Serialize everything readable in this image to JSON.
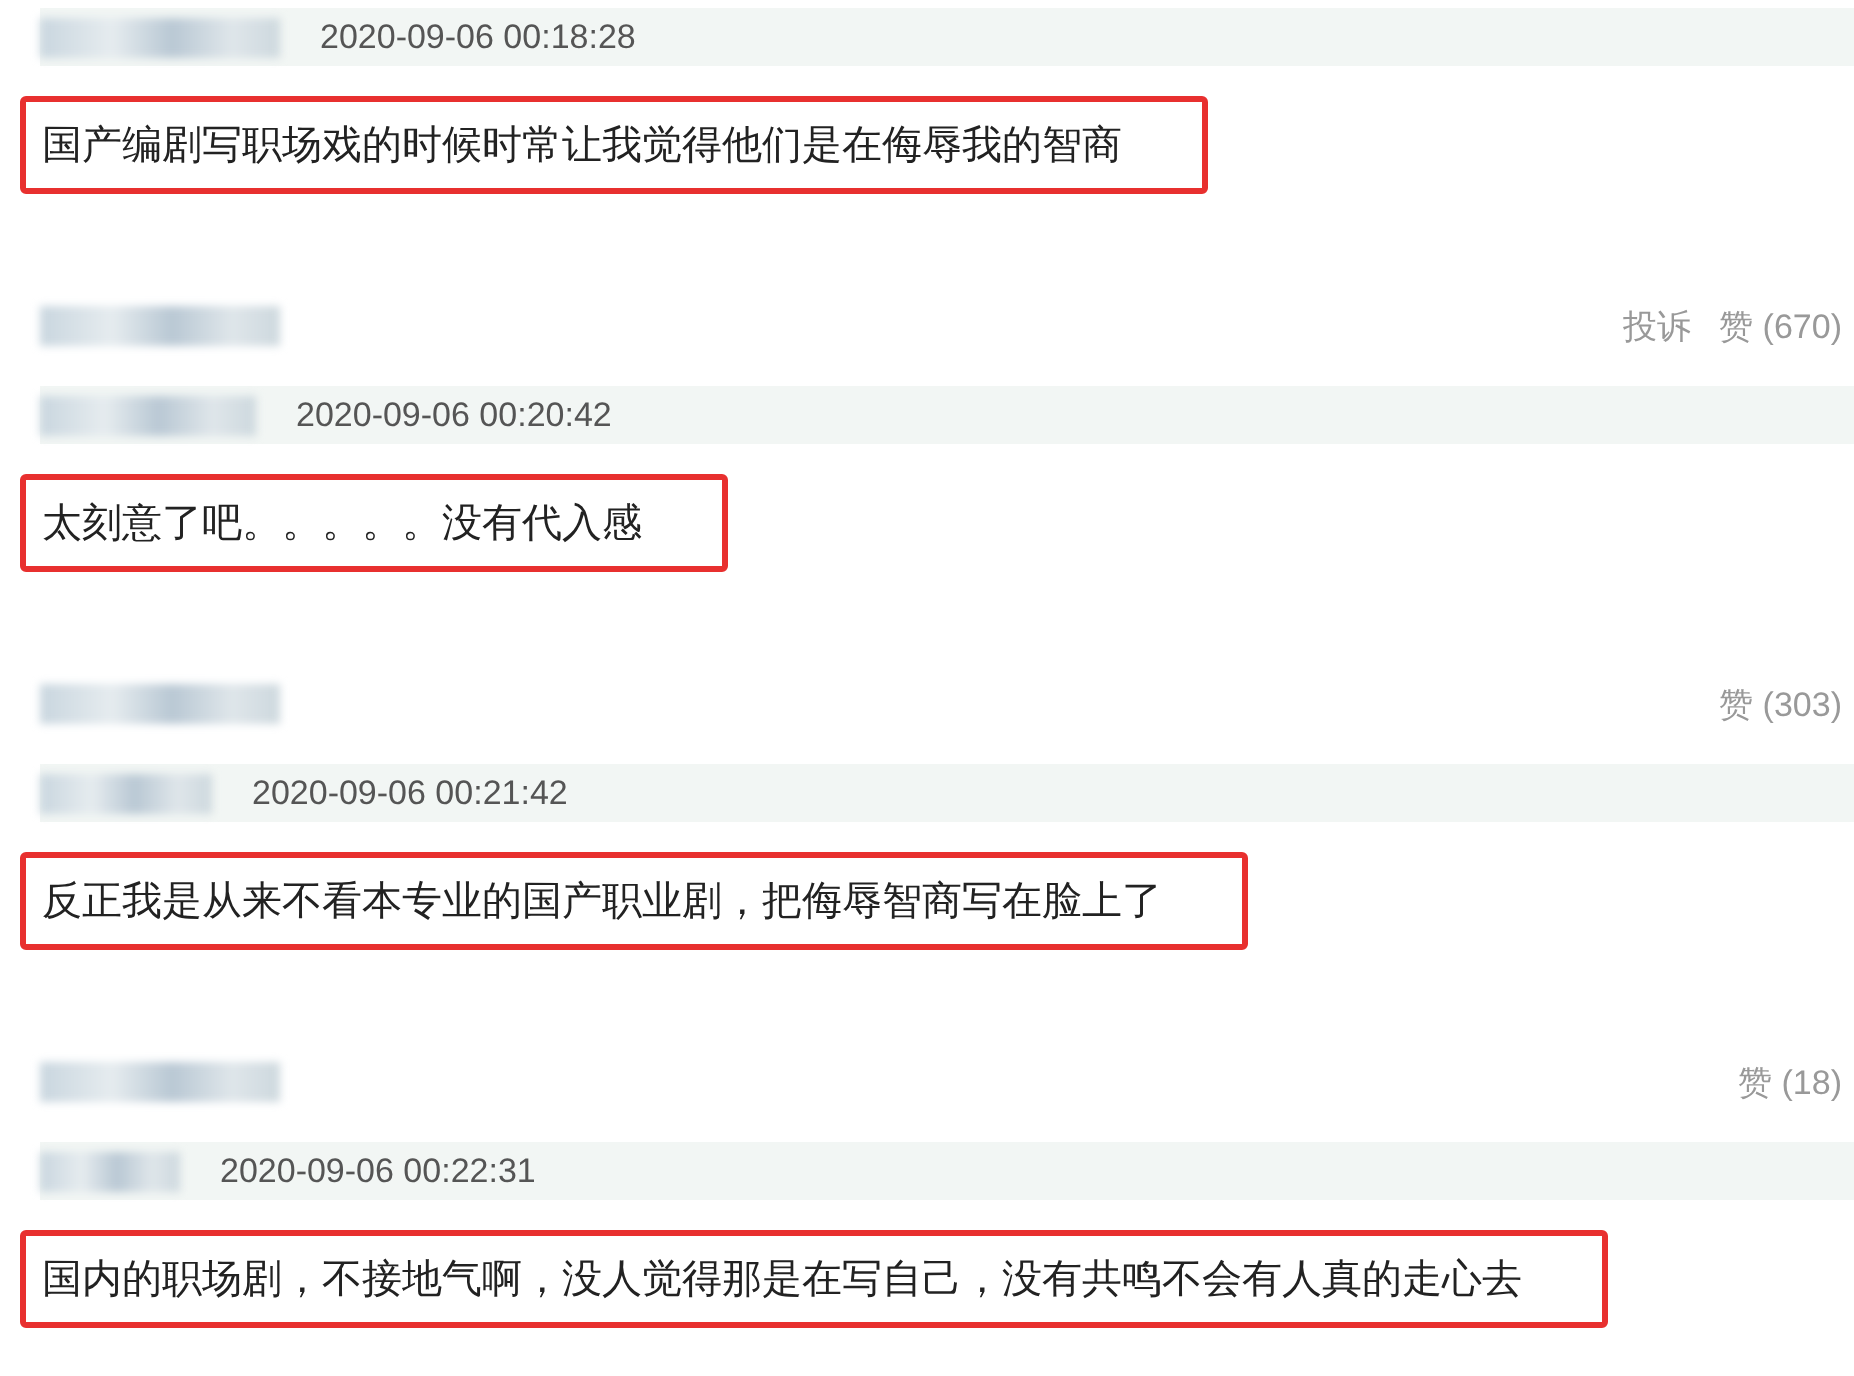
{
  "comments": [
    {
      "time": "2020-09-06 00:18:28",
      "text": "国产编剧写职场戏的时候时常让我觉得他们是在侮辱我的智商",
      "highlighted": true,
      "actions": [
        "投诉",
        "赞 (670)"
      ]
    },
    {
      "time": "2020-09-06 00:20:42",
      "text": "太刻意了吧。。。。。没有代入感",
      "highlighted": true,
      "actions": [
        "赞 (303)"
      ]
    },
    {
      "time": "2020-09-06 00:21:42",
      "text": "反正我是从来不看本专业的国产职业剧，把侮辱智商写在脸上了",
      "highlighted": true,
      "actions": [
        "赞 (18)"
      ]
    },
    {
      "time": "2020-09-06 00:22:31",
      "text": "国内的职场剧，不接地气啊，没人觉得那是在写自己，没有共鸣不会有人真的走心去",
      "highlighted": true
    }
  ]
}
